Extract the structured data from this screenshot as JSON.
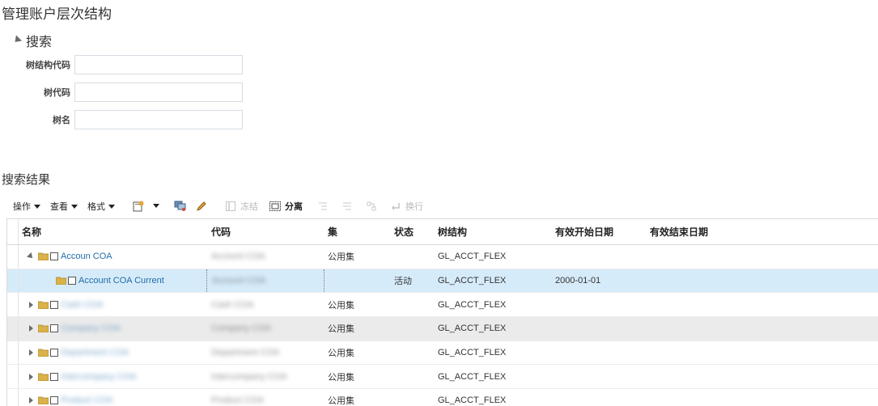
{
  "page": {
    "title": "管理账户层次结构"
  },
  "search": {
    "section_label": "搜索",
    "fields": [
      {
        "label": "树结构代码",
        "value": "",
        "placeholder": ""
      },
      {
        "label": "树代码",
        "value": "",
        "placeholder": ""
      },
      {
        "label": "树名",
        "value": "",
        "placeholder": ""
      }
    ]
  },
  "results": {
    "title": "搜索结果",
    "toolbar": {
      "actions_label": "操作",
      "view_label": "查看",
      "format_label": "格式",
      "freeze_label": "冻结",
      "detach_label": "分离",
      "wrap_label": "换行"
    },
    "columns": {
      "name": "名称",
      "code": "代码",
      "set": "集",
      "status": "状态",
      "structure": "树结构",
      "start": "有效开始日期",
      "end": "有效结束日期"
    },
    "rows": [
      {
        "name": "Accoun COA",
        "code": "Account COA",
        "set": "公用集",
        "status": "",
        "structure": "GL_ACCT_FLEX",
        "start": "",
        "end": "",
        "expanded": true,
        "level": 0
      },
      {
        "name": "Account COA Current",
        "code": "Account COA",
        "set": "",
        "status": "活动",
        "structure": "GL_ACCT_FLEX",
        "start": "2000-01-01",
        "end": "",
        "expanded": false,
        "level": 1
      },
      {
        "name": "Cash COA",
        "code": "Cash COA",
        "set": "公用集",
        "status": "",
        "structure": "GL_ACCT_FLEX",
        "start": "",
        "end": "",
        "expanded": false,
        "level": 0
      },
      {
        "name": "Company COA",
        "code": "Company COA",
        "set": "公用集",
        "status": "",
        "structure": "GL_ACCT_FLEX",
        "start": "",
        "end": "",
        "expanded": false,
        "level": 0
      },
      {
        "name": "Department COA",
        "code": "Department COA",
        "set": "公用集",
        "status": "",
        "structure": "GL_ACCT_FLEX",
        "start": "",
        "end": "",
        "expanded": false,
        "level": 0
      },
      {
        "name": "Intercompany COA",
        "code": "Intercompany COA",
        "set": "公用集",
        "status": "",
        "structure": "GL_ACCT_FLEX",
        "start": "",
        "end": "",
        "expanded": false,
        "level": 0
      },
      {
        "name": "Product COA",
        "code": "Product COA",
        "set": "公用集",
        "status": "",
        "structure": "GL_ACCT_FLEX",
        "start": "",
        "end": "",
        "expanded": false,
        "level": 0
      }
    ]
  },
  "colors": {
    "link": "#1f6ba8",
    "selected_row": "#d6ebfa",
    "hover_row": "#ebebeb",
    "folder": "#d9b24a"
  }
}
